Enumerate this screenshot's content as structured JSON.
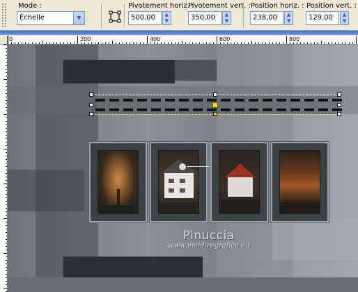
{
  "toolbar": {
    "mode_label": "Mode :",
    "mode_value": "Échelle",
    "pivot_h_label": "Pivotement horiz. :",
    "pivot_h_value": "500,00",
    "pivot_v_label": "Pivotement vert. :",
    "pivot_v_value": "350,00",
    "pos_h_label": "Position horiz. :",
    "pos_h_value": "238,00",
    "pos_v_label": "Position vert. :",
    "pos_v_value": "129,00"
  },
  "ruler": {
    "labels": [
      "0",
      "200",
      "400",
      "600",
      "800"
    ]
  },
  "watermark": {
    "name": "Pinuccia",
    "url": "www.maidiregrafica.eu"
  },
  "icons": [
    "grip-handle",
    "pick-tool-icon",
    "spin-up-icon",
    "spin-down-icon",
    "dropdown-arrow-icon",
    "rotation-handle-icon"
  ],
  "colors": {
    "canvas": "#7c8186",
    "frame": "#3d4345",
    "frame_border": "#9ea5a9",
    "selection_handle": "#ffd700",
    "toolbar": "#ece9d8"
  }
}
